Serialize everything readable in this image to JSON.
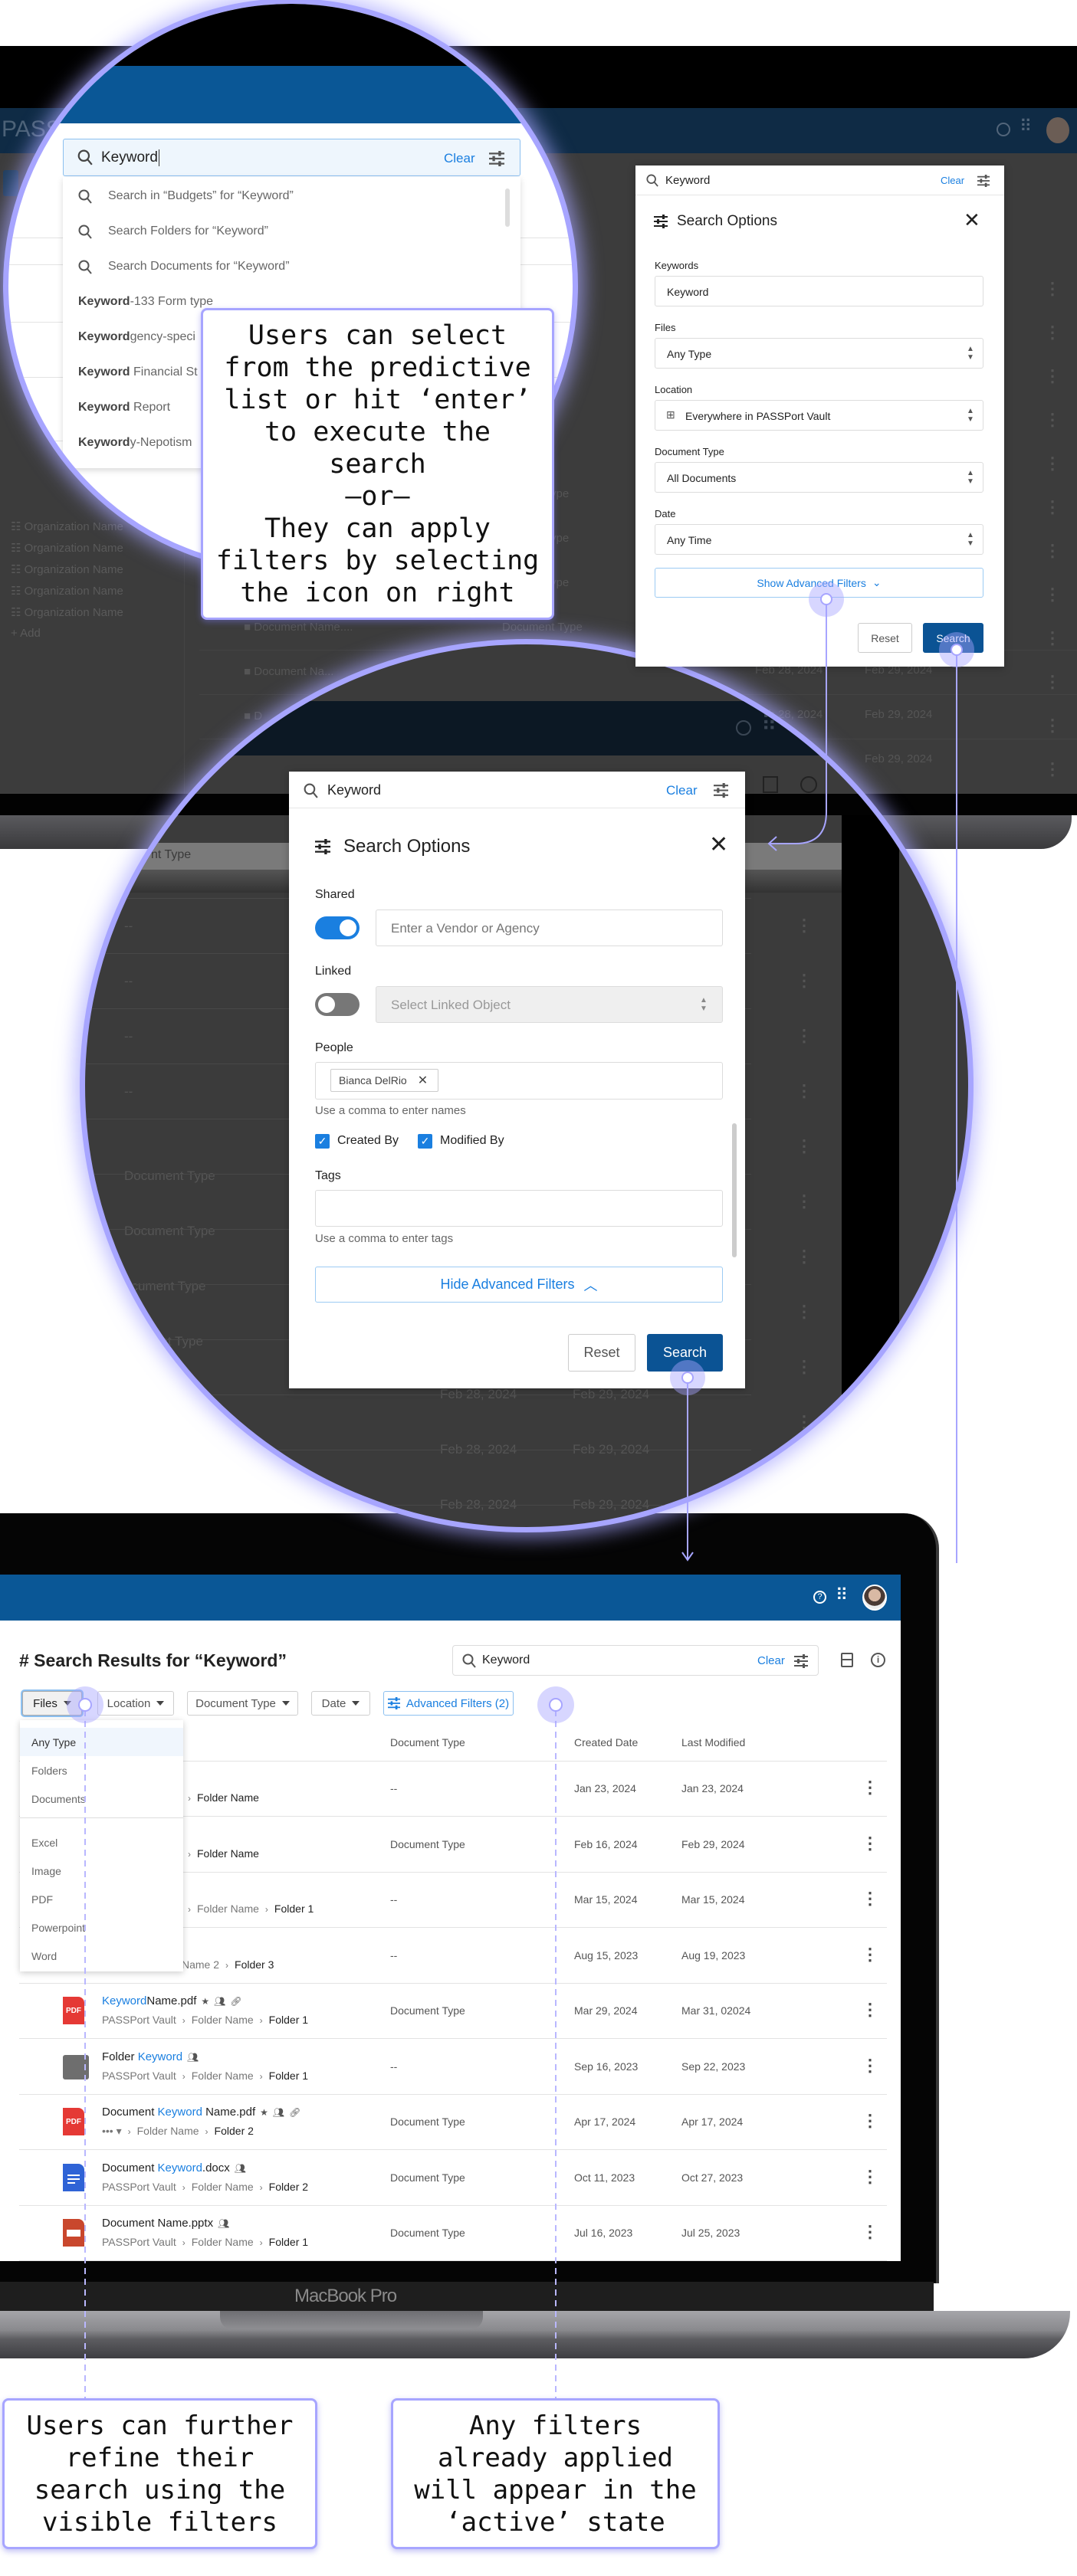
{
  "colors": {
    "brand": "#0a5796",
    "primary_button": "#0b5394",
    "link": "#1a7fe0",
    "annotation": "#a7a5ff"
  },
  "background_app": {
    "logo_partial": "PASSP",
    "sidebar": [
      "Organization Name",
      "Organization Name",
      "Organization Name",
      "Organization Name",
      "Organization Name"
    ],
    "sidebar_add": "Add",
    "rows": [
      {
        "name": "Document Name....",
        "type": "Document Type"
      },
      {
        "name": "Document Na...",
        "type": ""
      },
      {
        "name": "D",
        "type": ""
      }
    ],
    "dates": [
      [
        "Feb 28, 2024",
        "Feb 29, 2024"
      ],
      [
        "Feb 28, 2024",
        "Feb 29, 2024"
      ],
      [
        "",
        "Feb 29, 2024"
      ]
    ],
    "type_fragments": [
      "ype",
      "ype",
      "ype"
    ]
  },
  "predictive": {
    "search_value": "Keyword",
    "clear": "Clear",
    "suggestions": [
      "Search in “Budgets” for “Keyword”",
      "Search Folders for “Keyword”",
      "Search Documents for “Keyword”"
    ],
    "matches": [
      {
        "bold": "Keyword",
        "rest": "-133 Form type"
      },
      {
        "bold": "Keyword",
        "rest": "gency-speci"
      },
      {
        "bold": "Keyword",
        "rest": " Financial St"
      },
      {
        "bold": "Keyword",
        "rest": " Report"
      },
      {
        "bold": "Keyword",
        "rest": "y-Nepotism"
      }
    ],
    "sidebar": [
      "Organizati",
      "Organizati",
      "Organization N",
      "Organization Name",
      "Organization Name",
      "Organization Name"
    ]
  },
  "callouts": {
    "predictive": "Users can select\nfrom the predictive\nlist or hit ‘enter’\nto execute the\nsearch\n—or—\nThey can apply\nfilters by selecting\nthe icon on right",
    "visible_filters": "Users can further\nrefine their\nsearch using the\nvisible filters",
    "active_filters": "Any filters\nalready applied\nwill appear in the\n‘active’ state"
  },
  "search_options_basic": {
    "search_value": "Keyword",
    "clear": "Clear",
    "title": "Search Options",
    "keywords_label": "Keywords",
    "keywords_value": "Keyword",
    "files_label": "Files",
    "files_value": "Any Type",
    "location_label": "Location",
    "location_value": "Everywhere in PASSPort Vault",
    "doctype_label": "Document Type",
    "doctype_value": "All Documents",
    "date_label": "Date",
    "date_value": "Any Time",
    "show_advanced": "Show Advanced Filters",
    "reset": "Reset",
    "search": "Search"
  },
  "search_options_advanced": {
    "search_value": "Keyword",
    "clear": "Clear",
    "title": "Search Options",
    "shared_label": "Shared",
    "shared_on": true,
    "vendor_placeholder": "Enter a Vendor or Agency",
    "linked_label": "Linked",
    "linked_on": false,
    "linked_placeholder": "Select Linked Object",
    "people_label": "People",
    "people_chip": "Bianca DelRio",
    "people_help": "Use a comma to enter names",
    "created_by": "Created By",
    "created_by_checked": true,
    "modified_by": "Modified By",
    "modified_by_checked": true,
    "tags_label": "Tags",
    "tags_help": "Use a comma to enter tags",
    "hide_advanced": "Hide Advanced Filters",
    "reset": "Reset",
    "search": "Search"
  },
  "middle_bg": {
    "header_fragment": "nt Type",
    "dashes": [
      "--",
      "--",
      "--",
      "--"
    ],
    "types": [
      "Document Type",
      "Document Type",
      "ocument Type",
      "ent Type"
    ],
    "dates": [
      [
        "Feb 28, 2024",
        "Feb 29, 2024"
      ],
      [
        "Feb 28, 2024",
        "Feb 29, 2024"
      ],
      [
        "Feb 28, 2024",
        "Feb 29, 2024"
      ]
    ]
  },
  "results": {
    "title": "# Search Results for “Keyword”",
    "search_value": "Keyword",
    "clear": "Clear",
    "filters": [
      {
        "label": "Files",
        "active": true
      },
      {
        "label": "Location",
        "active": false
      },
      {
        "label": "Document Type",
        "active": false
      },
      {
        "label": "Date",
        "active": false
      }
    ],
    "advanced_filters": "Advanced Filters (2)",
    "files_menu": {
      "group1": [
        "Any Type",
        "Folders",
        "Documents"
      ],
      "group2": [
        "Excel",
        "Image",
        "PDF",
        "Powerpoint",
        "Word"
      ],
      "selected": "Any Type"
    },
    "columns": {
      "doc_type": "Document Type",
      "created": "Created Date",
      "modified": "Last Modified"
    },
    "rows": [
      {
        "icon": "",
        "name": [],
        "badges": [],
        "path": [
          "Folder Name"
        ],
        "path_prefix": "",
        "doc_type": "--",
        "created": "Jan 23, 2024",
        "modified": "Jan 23, 2024"
      },
      {
        "icon": "",
        "name": [],
        "badges": [],
        "path": [
          "Folder Name"
        ],
        "path_prefix": "",
        "doc_type": "Document Type",
        "created": "Feb 16, 2024",
        "modified": "Feb 29, 2024"
      },
      {
        "icon": "",
        "name": [],
        "badges": [],
        "path": [
          "Folder Name",
          "Folder 1"
        ],
        "path_prefix": "",
        "doc_type": "--",
        "created": "Mar 15, 2024",
        "modified": "Mar 15, 2024"
      },
      {
        "icon": "",
        "name": [],
        "badges": [],
        "path": [
          "Folder 3"
        ],
        "path_prefix": "Name 2",
        "doc_type": "--",
        "created": "Aug 15, 2023",
        "modified": "Aug 19, 2023"
      },
      {
        "icon": "pdf",
        "name": [
          {
            "text": "Keyword",
            "hl": true
          },
          {
            "text": "Name.pdf",
            "hl": false
          }
        ],
        "badges": [
          "star",
          "people",
          "link"
        ],
        "path": [
          "PASSPort Vault",
          "Folder Name",
          "Folder 1"
        ],
        "doc_type": "Document Type",
        "created": "Mar 29, 2024",
        "modified": "Mar 31, 02024"
      },
      {
        "icon": "folder",
        "name": [
          {
            "text": "Folder ",
            "hl": false
          },
          {
            "text": "Keyword",
            "hl": true
          }
        ],
        "badges": [
          "people"
        ],
        "path": [
          "PASSPort Vault",
          "Folder Name",
          "Folder 1"
        ],
        "doc_type": "--",
        "created": "Sep 16, 2023",
        "modified": "Sep 22, 2023"
      },
      {
        "icon": "pdf",
        "name": [
          {
            "text": "Document ",
            "hl": false
          },
          {
            "text": "Keyword",
            "hl": true
          },
          {
            "text": " Name.pdf",
            "hl": false
          }
        ],
        "badges": [
          "star",
          "people",
          "link"
        ],
        "path": [
          "••• ▾",
          "Folder Name",
          "Folder 2"
        ],
        "doc_type": "Document Type",
        "created": "Apr 17, 2024",
        "modified": "Apr 17, 2024"
      },
      {
        "icon": "docx",
        "name": [
          {
            "text": "Document ",
            "hl": false
          },
          {
            "text": "Keyword",
            "hl": true
          },
          {
            "text": ".docx",
            "hl": false
          }
        ],
        "badges": [
          "people"
        ],
        "path": [
          "PASSPort Vault",
          "Folder Name",
          "Folder 2"
        ],
        "doc_type": "Document Type",
        "created": "Oct 11, 2023",
        "modified": "Oct 27, 2023"
      },
      {
        "icon": "pptx",
        "name": [
          {
            "text": "Document Name.pptx",
            "hl": false
          }
        ],
        "badges": [
          "people"
        ],
        "path": [
          "PASSPort Vault",
          "Folder Name",
          "Folder 1"
        ],
        "doc_type": "Document Type",
        "created": "Jul 16, 2023",
        "modified": "Jul 25, 2023"
      }
    ]
  },
  "laptop": {
    "brand_label": "MacBook Pro"
  }
}
